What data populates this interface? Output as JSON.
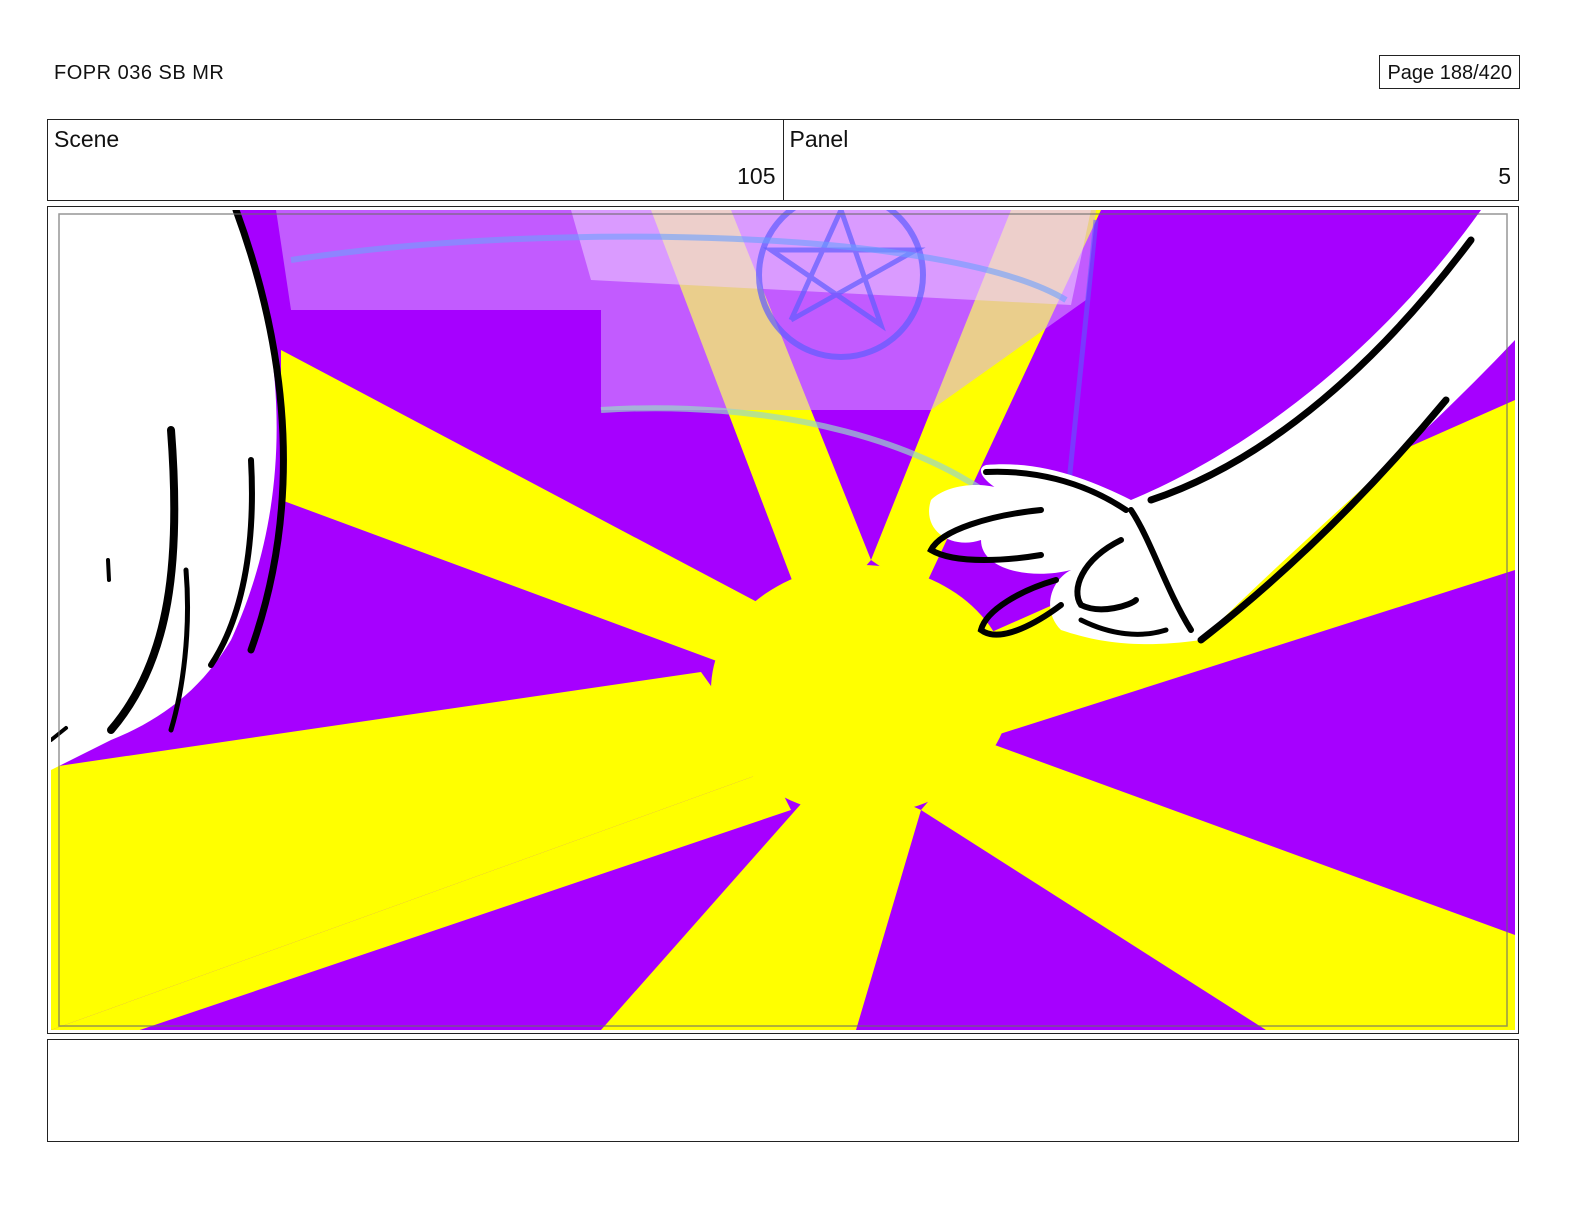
{
  "header": {
    "title": "FOPR 036 SB MR",
    "page": "Page 188/420"
  },
  "scene": {
    "label": "Scene",
    "value": "105"
  },
  "panel": {
    "label": "Panel",
    "value": "5"
  },
  "notes": {
    "text": ""
  },
  "colors": {
    "ray_yellow": "#ffff00",
    "background_purple": "#a600ff",
    "overlay_lavender": "#c58cff",
    "sketch_blue": "#5e5cff",
    "frame_border": "#222222"
  }
}
